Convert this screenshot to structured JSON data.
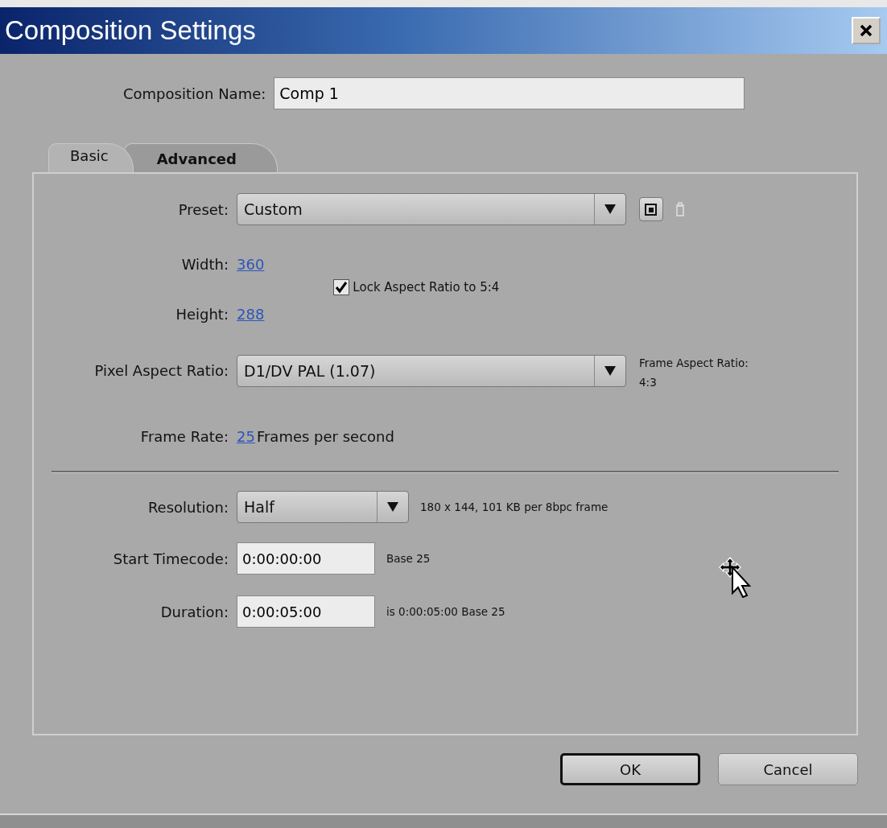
{
  "window": {
    "title": "Composition Settings"
  },
  "composition_name": {
    "label": "Composition Name:",
    "value": "Comp 1"
  },
  "tabs": [
    {
      "label": "Basic",
      "selected": true
    },
    {
      "label": "Advanced",
      "selected": false
    }
  ],
  "preset": {
    "label": "Preset:",
    "value": "Custom",
    "delete_disabled": true
  },
  "width": {
    "label": "Width:",
    "value": "360"
  },
  "height": {
    "label": "Height:",
    "value": "288"
  },
  "lock_aspect": {
    "label": "Lock Aspect Ratio to 5:4",
    "checked": true
  },
  "pixel_aspect_ratio": {
    "label": "Pixel Aspect Ratio:",
    "value": "D1/DV PAL (1.07)",
    "frame_aspect_label": "Frame Aspect Ratio:",
    "frame_aspect_value": "4:3"
  },
  "frame_rate": {
    "label": "Frame Rate:",
    "value": "25",
    "unit": "Frames per second"
  },
  "resolution": {
    "label": "Resolution:",
    "value": "Half",
    "info": "180 x 144, 101 KB per 8bpc frame"
  },
  "start_timecode": {
    "label": "Start Timecode:",
    "value": "0:00:00:00",
    "note": "Base 25"
  },
  "duration": {
    "label": "Duration:",
    "value": "0:00:05:00",
    "note": "is 0:00:05:00 Base 25"
  },
  "buttons": [
    {
      "label": "OK",
      "default": true
    },
    {
      "label": "Cancel",
      "default": false
    }
  ]
}
